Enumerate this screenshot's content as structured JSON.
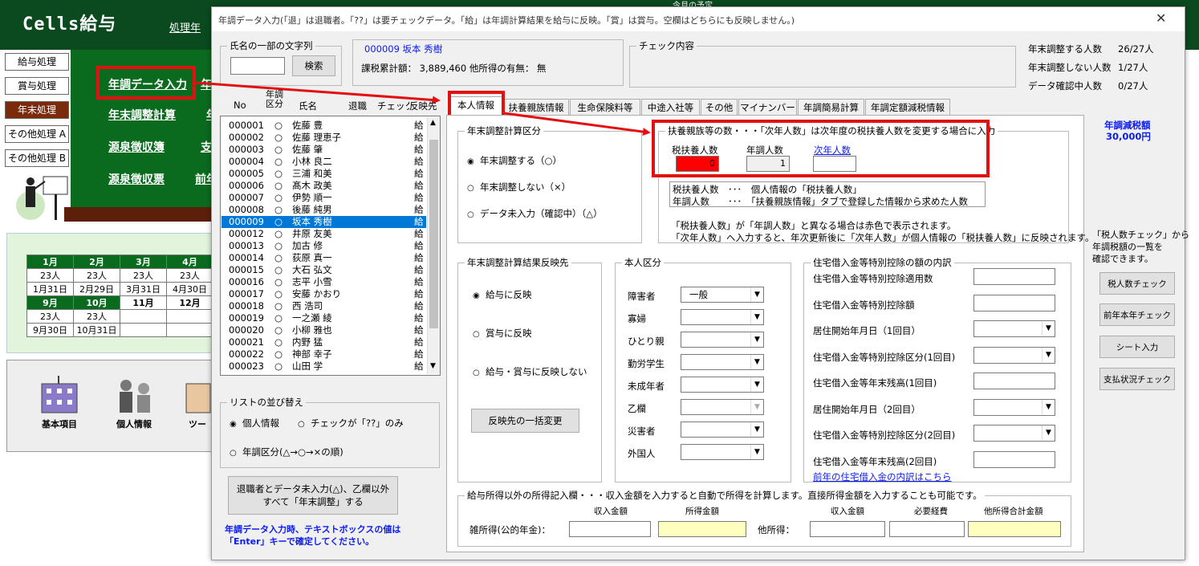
{
  "bg": {
    "title": "Cells給与",
    "proc": "処理年",
    "sched": "今月の予定",
    "nav": [
      "給与処理",
      "賞与処理",
      "年末処理",
      "その他処理 A",
      "その他処理 B"
    ],
    "links": [
      "年調データ入力",
      "年末調整計算",
      "源泉徴収簿",
      "源泉徴収票"
    ],
    "links_cut": [
      "年",
      "年",
      "支",
      "前年"
    ],
    "calendar": [
      [
        "1月",
        "2月",
        "3月",
        "4月"
      ],
      [
        "23人",
        "23人",
        "23人",
        "23人"
      ],
      [
        "1月31日",
        "2月29日",
        "3月31日",
        "4月30日"
      ],
      [
        "9月",
        "10月",
        "11月",
        "12月"
      ],
      [
        "23人",
        "23人",
        "",
        ""
      ],
      [
        "9月30日",
        "10月31日",
        "",
        ""
      ]
    ],
    "tiles": [
      "基本項目",
      "個人情報",
      "ツー"
    ]
  },
  "dialog": {
    "title": "年調データ入力(「退」は退職者。「??」は要チェックデータ。「給」は年調計算結果を給与に反映。「賞」は賞与。空欄はどちらにも反映しません。)",
    "close": "✕",
    "search": {
      "legend": "氏名の一部の文字列",
      "button": "検索",
      "value": ""
    },
    "employee": {
      "header": "000009 坂本 秀樹",
      "info": "課税累計額： 3,889,460 他所得の有無： 無"
    },
    "check": {
      "legend": "チェック内容"
    },
    "stats": [
      {
        "label": "年末調整する人数",
        "value": "26/27人"
      },
      {
        "label": "年末調整しない人数",
        "value": "1/27人"
      },
      {
        "label": "データ確認中人数",
        "value": "0/27人"
      }
    ],
    "list_headers": [
      "No",
      "年調区分",
      "氏名",
      "退職",
      "チェック",
      "反映先"
    ],
    "rows": [
      [
        "000001",
        "○",
        "佐藤 豊",
        "給"
      ],
      [
        "000002",
        "○",
        "佐藤 理恵子",
        "給"
      ],
      [
        "000003",
        "○",
        "佐藤 肇",
        "給"
      ],
      [
        "000004",
        "○",
        "小林 良二",
        "給"
      ],
      [
        "000005",
        "○",
        "三浦 和美",
        "給"
      ],
      [
        "000006",
        "○",
        "髙木 政美",
        "給"
      ],
      [
        "000007",
        "○",
        "伊勢 順一",
        "給"
      ],
      [
        "000008",
        "○",
        "後藤 純男",
        "給"
      ],
      [
        "000009",
        "○",
        "坂本 秀樹",
        "給"
      ],
      [
        "000012",
        "○",
        "井原 友美",
        "給"
      ],
      [
        "000013",
        "○",
        "加古 修",
        "給"
      ],
      [
        "000014",
        "○",
        "荻原 真一",
        "給"
      ],
      [
        "000015",
        "○",
        "大石 弘文",
        "給"
      ],
      [
        "000016",
        "○",
        "志平 小雪",
        "給"
      ],
      [
        "000017",
        "○",
        "安藤 かおり",
        "給"
      ],
      [
        "000018",
        "○",
        "西 浩司",
        "給"
      ],
      [
        "000019",
        "○",
        "一之瀬 綾",
        "給"
      ],
      [
        "000020",
        "○",
        "小柳 雅也",
        "給"
      ],
      [
        "000021",
        "○",
        "内野 猛",
        "給"
      ],
      [
        "000022",
        "○",
        "神部 幸子",
        "給"
      ],
      [
        "000023",
        "○",
        "山田 学",
        "給"
      ]
    ],
    "sort": {
      "legend": "リストの並び替え",
      "opt1": "個人情報",
      "opt2": "チェックが「??」のみ",
      "opt3": "年調区分(△→○→×の順)"
    },
    "bulk_button": [
      "退職者とデータ未入力(△)、乙欄以外",
      "すべて「年末調整」する"
    ],
    "note": [
      "年調データ入力時、テキストボックスの値は",
      "「Enter」キーで確定してください。"
    ],
    "tabs": [
      "本人情報",
      "扶養親族情報",
      "生命保険料等",
      "中途入社等",
      "その他",
      "マイナンバー",
      "年調簡易計算",
      "年調定額減税情報"
    ],
    "calc": {
      "legend": "年末調整計算区分",
      "opt1": "年末調整する（○）",
      "opt2": "年末調整しない（×）",
      "opt3": "データ未入力（確認中）（△）"
    },
    "dep": {
      "legend": "扶養親族等の数・・・「次年人数」は次年度の税扶養人数を変更する場合に入力",
      "col1": "税扶養人数",
      "col2": "年調人数",
      "col3": "次年人数",
      "val1": "0",
      "val2": "1",
      "val3": "",
      "expl1": "税扶養人数　･･･　個人情報の「税扶養人数」",
      "expl2": "年調人数　　･･･　「扶養親族情報」タブで登録した情報から求めた人数",
      "note1": "「税扶養人数」が「年調人数」と異なる場合は赤色で表示されます。",
      "note2": "「次年人数」へ入力すると、年次更新後に「次年人数」が個人情報の「税扶養人数」に反映されます。"
    },
    "reflect": {
      "legend": "年末調整計算結果反映先",
      "opt1": "給与に反映",
      "opt2": "賞与に反映",
      "opt3": "給与・賞与に反映しない",
      "button": "反映先の一括変更"
    },
    "self": {
      "legend": "本人区分",
      "items": [
        {
          "label": "障害者",
          "value": "一般"
        },
        {
          "label": "寡婦",
          "value": ""
        },
        {
          "label": "ひとり親",
          "value": ""
        },
        {
          "label": "勤労学生",
          "value": ""
        },
        {
          "label": "未成年者",
          "value": ""
        },
        {
          "label": "乙欄",
          "value": ""
        },
        {
          "label": "災害者",
          "value": ""
        },
        {
          "label": "外国人",
          "value": ""
        }
      ]
    },
    "housing": {
      "legend": "住宅借入金等特別控除の額の内訳",
      "items": [
        "住宅借入金等特別控除適用数",
        "住宅借入金等特別控除額",
        "居住開始年月日（1回目）",
        "住宅借入金等特別控除区分(1回目)",
        "住宅借入金等年末残高(1回目)",
        "居住開始年月日（2回目）",
        "住宅借入金等特別控除区分(2回目)",
        "住宅借入金等年末残高(2回目)"
      ],
      "link": "前年の住宅借入金の内訳はこちら"
    },
    "income": {
      "legend": "給与所得以外の所得記入欄・・・収入金額を入力すると自動で所得を計算します。直接所得金額を入力することも可能です。",
      "h1": "収入金額",
      "h2": "所得金額",
      "h3": "収入金額",
      "h4": "必要経費",
      "h5": "他所得合計金額",
      "label1": "雑所得(公的年金)：",
      "label2": "他所得："
    },
    "right": {
      "title": "年調減税額",
      "amount": "30,000円",
      "desc": [
        "「税人数チェック」から",
        "年調税額の一覧を",
        "確認できます。"
      ],
      "buttons": [
        "税人数チェック",
        "前年本年チェック",
        "シート入力",
        "支払状況チェック"
      ]
    }
  },
  "colors": {
    "highlight": "#e21010",
    "selection": "#0078d7",
    "link": "#0b1cf0",
    "bg_green": "#0a6a1e"
  }
}
